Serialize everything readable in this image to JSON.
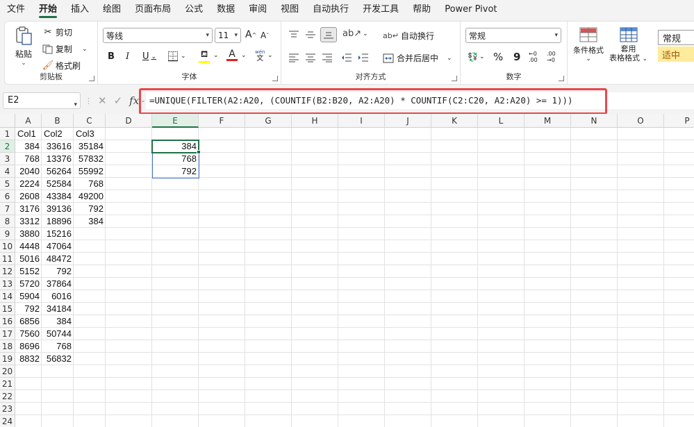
{
  "menu": [
    "文件",
    "开始",
    "插入",
    "绘图",
    "页面布局",
    "公式",
    "数据",
    "审阅",
    "视图",
    "自动执行",
    "开发工具",
    "帮助",
    "Power Pivot"
  ],
  "active_menu_index": 1,
  "ribbon": {
    "clipboard": {
      "label": "剪贴板",
      "paste": "粘贴",
      "cut": "剪切",
      "copy": "复制",
      "format_painter": "格式刷"
    },
    "font": {
      "label": "字体",
      "font_name": "等线",
      "font_size": "11",
      "bold": "B",
      "italic": "I",
      "underline": "U",
      "grow": "A",
      "shrink": "A",
      "phonetic_top": "wén",
      "phonetic_bottom": "文",
      "font_color": "A"
    },
    "alignment": {
      "label": "对齐方式",
      "wrap_text": "自动换行",
      "merge_center": "合并后居中"
    },
    "number": {
      "label": "数字",
      "format": "常规",
      "percent": "%",
      "comma": "9",
      "inc_decimal": "←0 .00",
      "dec_decimal": ".00 →0"
    },
    "styles": {
      "conditional": "条件格式",
      "table_format_1": "套用",
      "table_format_2": "表格格式",
      "style_normal": "常规",
      "style_neutral": "适中"
    }
  },
  "formula_bar": {
    "name_box": "E2",
    "fx": "fx",
    "formula": "=UNIQUE(FILTER(A2:A20, (COUNTIF(B2:B20, A2:A20) * COUNTIF(C2:C20, A2:A20) >= 1)))"
  },
  "grid": {
    "columns": [
      "A",
      "B",
      "C",
      "D",
      "E",
      "F",
      "G",
      "H",
      "I",
      "J",
      "K",
      "L",
      "M",
      "N",
      "O",
      "P"
    ],
    "rows": [
      "1",
      "2",
      "3",
      "4",
      "5",
      "6",
      "7",
      "8",
      "9",
      "10",
      "11",
      "12",
      "13",
      "14",
      "15",
      "16",
      "17",
      "18",
      "19",
      "20",
      "21",
      "22",
      "23",
      "24"
    ],
    "selected_column": "E",
    "selected_row": "2",
    "col_a": [
      "Col1",
      "384",
      "768",
      "2040",
      "2224",
      "2608",
      "3176",
      "3312",
      "3880",
      "4448",
      "5016",
      "5152",
      "5720",
      "5904",
      "792",
      "6856",
      "7560",
      "8696",
      "8832"
    ],
    "col_b": [
      "Col2",
      "33616",
      "13376",
      "56264",
      "52584",
      "43384",
      "39136",
      "18896",
      "15216",
      "47064",
      "48472",
      "792",
      "37864",
      "6016",
      "34184",
      "384",
      "50744",
      "768",
      "56832"
    ],
    "col_c": [
      "Col3",
      "35184",
      "57832",
      "55992",
      "768",
      "49200",
      "792",
      "384"
    ],
    "col_e": [
      "",
      "384",
      "768",
      "792"
    ]
  },
  "colors": {
    "accent": "#1e7145",
    "highlight": "#e8474c",
    "spill_border": "#4472c4",
    "style_neutral_bg": "#ffeb9c"
  }
}
